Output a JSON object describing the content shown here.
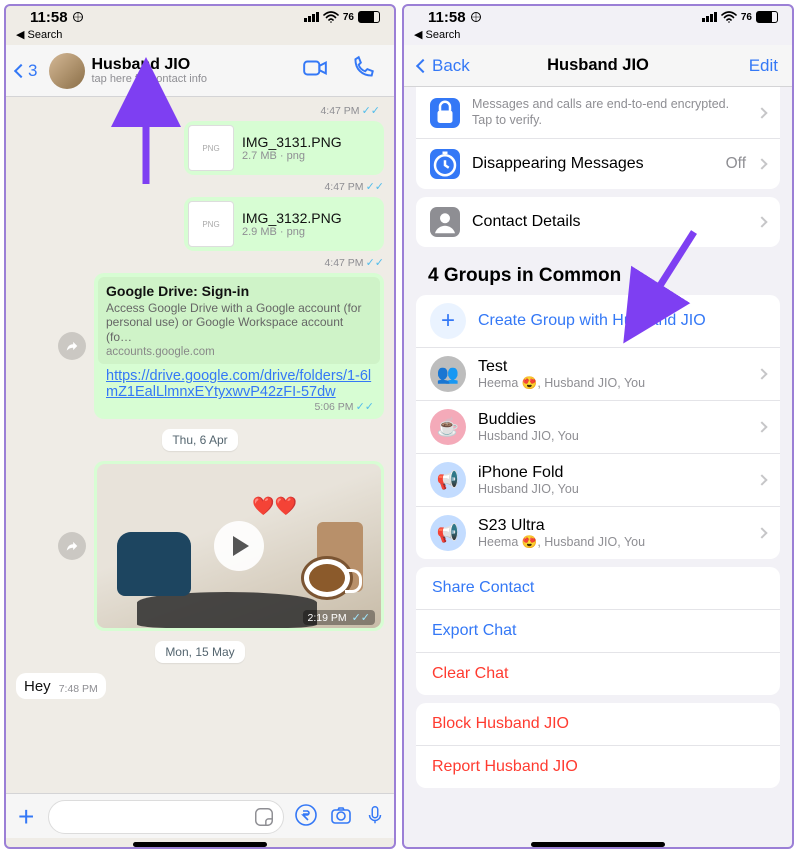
{
  "status": {
    "time": "11:58",
    "battery": "76",
    "search_back": "Search"
  },
  "chat": {
    "badge": "3",
    "name": "Husband JIO",
    "sub": "tap here for contact info",
    "t0": "4:47 PM",
    "file1": {
      "name": "IMG_3131.PNG",
      "meta": "2.7 MB · png",
      "time": "4:47 PM"
    },
    "file2": {
      "name": "IMG_3132.PNG",
      "meta": "2.9 MB · png",
      "time": "4:47 PM"
    },
    "link": {
      "title": "Google Drive: Sign-in",
      "desc": "Access Google Drive with a Google account (for personal use) or Google Workspace account (fo…",
      "domain": "accounts.google.com",
      "url": "https://drive.google.com/drive/folders/1-6lmZ1EalLlmnxEYtyxwvP42zFI-57dw",
      "time": "5:06 PM"
    },
    "date1": "Thu, 6 Apr",
    "video_time": "2:19 PM",
    "date2": "Mon, 15 May",
    "in_msg": {
      "text": "Hey",
      "time": "7:48 PM"
    }
  },
  "info": {
    "back": "Back",
    "title": "Husband JIO",
    "edit": "Edit",
    "encryption_text": "Messages and calls are end-to-end encrypted. Tap to verify.",
    "disappearing": "Disappearing Messages",
    "disappearing_state": "Off",
    "contact_details": "Contact Details",
    "groups_title": "4 Groups in Common",
    "create_group": "Create Group with Husband JIO",
    "groups": [
      {
        "name": "Test",
        "members": "Heema 😍, Husband JIO, You",
        "color": "gray"
      },
      {
        "name": "Buddies",
        "members": "Husband JIO, You",
        "color": "pink"
      },
      {
        "name": "iPhone Fold",
        "members": "Husband JIO, You",
        "color": "blue"
      },
      {
        "name": "S23 Ultra",
        "members": "Heema 😍, Husband JIO, You",
        "color": "blue"
      }
    ],
    "share": "Share Contact",
    "export": "Export Chat",
    "clear": "Clear Chat",
    "block": "Block Husband JIO",
    "report": "Report Husband JIO"
  }
}
